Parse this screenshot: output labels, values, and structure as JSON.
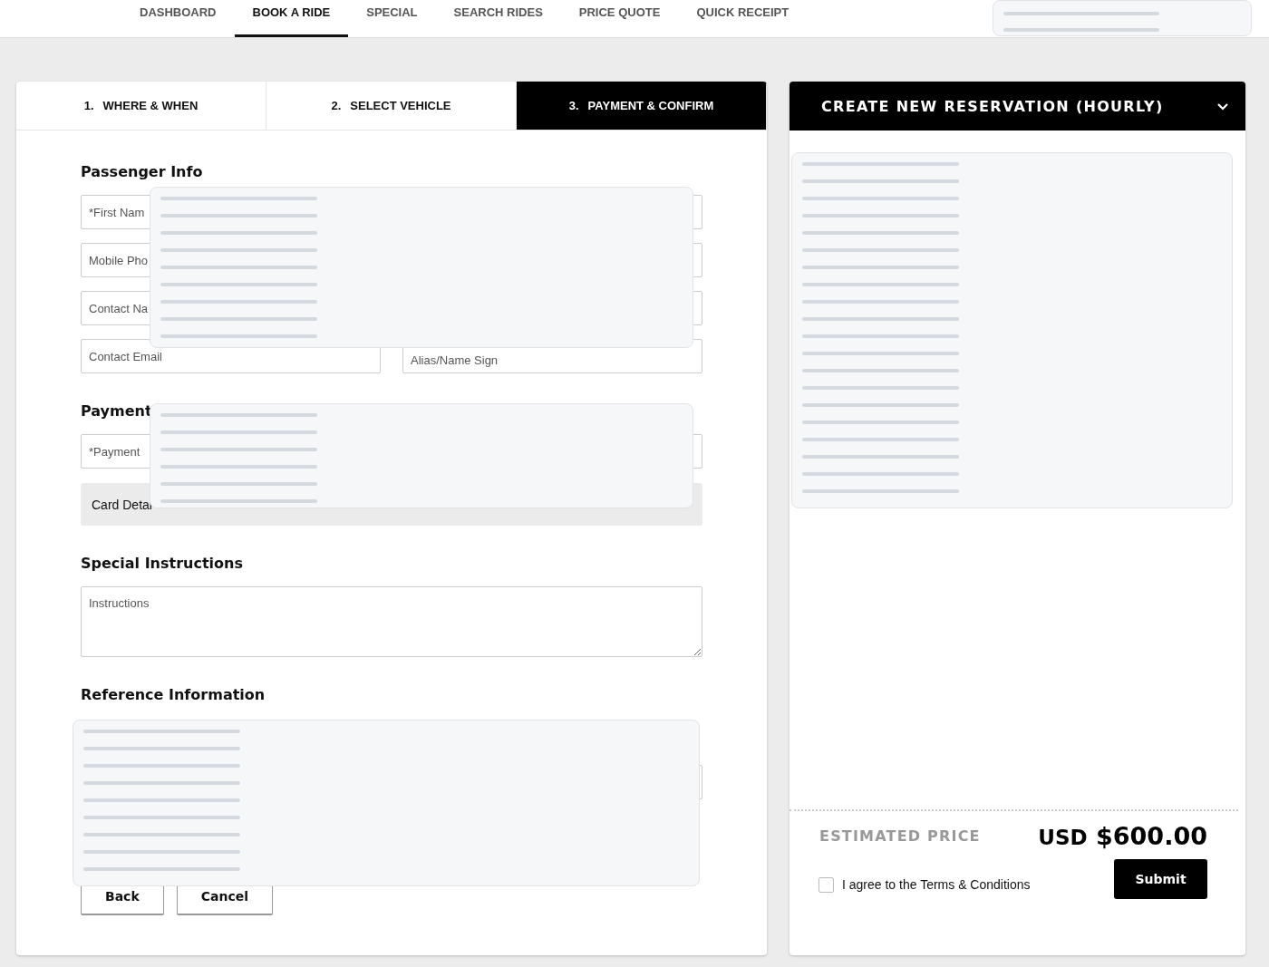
{
  "nav": {
    "items": [
      {
        "label": "DASHBOARD",
        "selected": false
      },
      {
        "label": "BOOK A RIDE",
        "selected": true
      },
      {
        "label": "SPECIAL",
        "selected": false
      },
      {
        "label": "SEARCH RIDES",
        "selected": false
      },
      {
        "label": "PRICE QUOTE",
        "selected": false
      },
      {
        "label": "QUICK RECEIPT",
        "selected": false
      }
    ]
  },
  "steps": [
    {
      "number": "1.",
      "label": "WHERE & WHEN",
      "selected": false
    },
    {
      "number": "2.",
      "label": "SELECT VEHICLE",
      "selected": false
    },
    {
      "number": "3.",
      "label": "PAYMENT & CONFIRM",
      "selected": true
    }
  ],
  "passenger_info": {
    "title": "Passenger Info",
    "fields": [
      {
        "kind": "text",
        "placeholder": "*First Nam"
      },
      {
        "kind": "blank"
      },
      {
        "kind": "text",
        "placeholder": "Mobile Pho"
      },
      {
        "kind": "blank"
      },
      {
        "kind": "text",
        "placeholder": "Contact Na"
      },
      {
        "kind": "blank"
      },
      {
        "kind": "text",
        "placeholder": "Contact Email"
      },
      {
        "kind": "text",
        "placeholder": "Alias/Name Sign"
      }
    ]
  },
  "payment": {
    "title": "Payment",
    "placeholder": "*Payment",
    "card_details": "Card Detai"
  },
  "special_instructions": {
    "title": "Special Instructions",
    "placeholder": "Instructions"
  },
  "reference_information": {
    "title": "Reference Information"
  },
  "buttons": [
    "Back",
    "Cancel"
  ],
  "reservation": {
    "title": "CREATE NEW RESERVATION (HOURLY)",
    "expanded": true,
    "estimated_price_label": "ESTIMATED PRICE",
    "currency": "USD",
    "amount": "$600.00",
    "terms": {
      "label": "I agree to the Terms & Conditions",
      "checked": false
    },
    "submit": "Submit"
  }
}
